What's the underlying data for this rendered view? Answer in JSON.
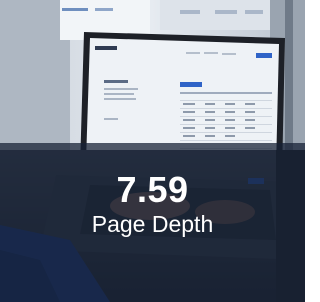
{
  "stat": {
    "value": "7.59",
    "label": "Page Depth"
  },
  "colors": {
    "overlay": "#162034",
    "text": "#ffffff"
  },
  "background": {
    "subject": "laptop-showing-dashboard-photo"
  }
}
